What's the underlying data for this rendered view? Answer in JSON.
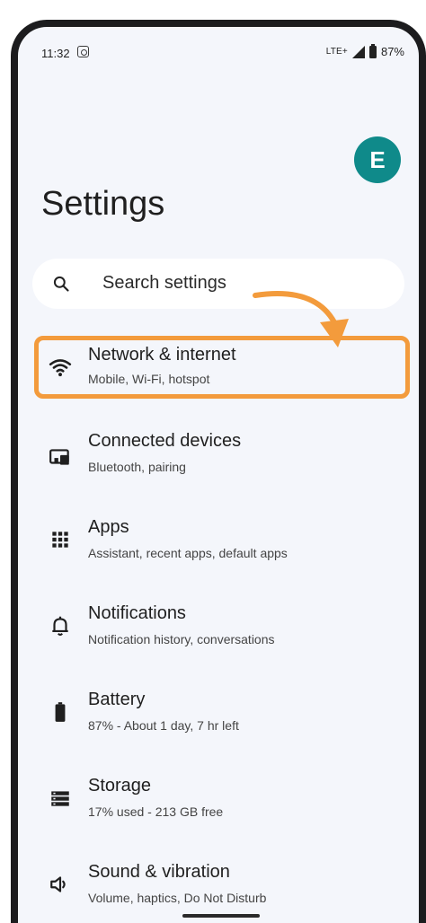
{
  "status_bar": {
    "time": "11:32",
    "network": "LTE+",
    "battery": "87%"
  },
  "header": {
    "avatar_letter": "E",
    "title": "Settings"
  },
  "search": {
    "placeholder": "Search settings"
  },
  "items": [
    {
      "title": "Network & internet",
      "subtitle": "Mobile, Wi-Fi, hotspot",
      "icon": "wifi-icon"
    },
    {
      "title": "Connected devices",
      "subtitle": "Bluetooth, pairing",
      "icon": "connected-devices-icon"
    },
    {
      "title": "Apps",
      "subtitle": "Assistant, recent apps, default apps",
      "icon": "apps-grid-icon"
    },
    {
      "title": "Notifications",
      "subtitle": "Notification history, conversations",
      "icon": "bell-icon"
    },
    {
      "title": "Battery",
      "subtitle": "87% - About 1 day, 7 hr left",
      "icon": "battery-icon"
    },
    {
      "title": "Storage",
      "subtitle": "17% used - 213 GB free",
      "icon": "storage-icon"
    },
    {
      "title": "Sound & vibration",
      "subtitle": "Volume, haptics, Do Not Disturb",
      "icon": "speaker-icon"
    }
  ],
  "colors": {
    "highlight": "#f39b3c",
    "avatar": "#0f8a8a",
    "background": "#f4f6fb"
  }
}
